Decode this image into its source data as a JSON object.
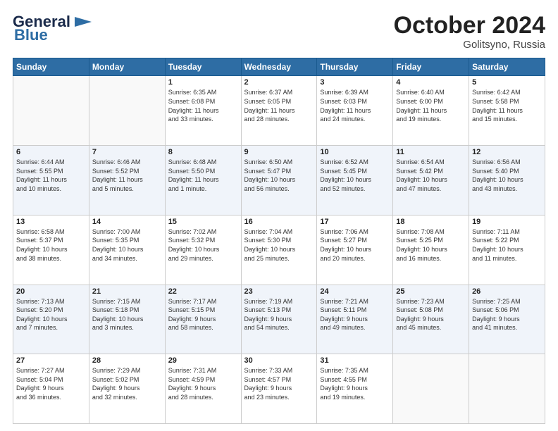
{
  "header": {
    "logo_line1": "General",
    "logo_line2": "Blue",
    "month_year": "October 2024",
    "location": "Golitsyno, Russia"
  },
  "weekdays": [
    "Sunday",
    "Monday",
    "Tuesday",
    "Wednesday",
    "Thursday",
    "Friday",
    "Saturday"
  ],
  "weeks": [
    [
      {
        "day": "",
        "detail": ""
      },
      {
        "day": "",
        "detail": ""
      },
      {
        "day": "1",
        "detail": "Sunrise: 6:35 AM\nSunset: 6:08 PM\nDaylight: 11 hours\nand 33 minutes."
      },
      {
        "day": "2",
        "detail": "Sunrise: 6:37 AM\nSunset: 6:05 PM\nDaylight: 11 hours\nand 28 minutes."
      },
      {
        "day": "3",
        "detail": "Sunrise: 6:39 AM\nSunset: 6:03 PM\nDaylight: 11 hours\nand 24 minutes."
      },
      {
        "day": "4",
        "detail": "Sunrise: 6:40 AM\nSunset: 6:00 PM\nDaylight: 11 hours\nand 19 minutes."
      },
      {
        "day": "5",
        "detail": "Sunrise: 6:42 AM\nSunset: 5:58 PM\nDaylight: 11 hours\nand 15 minutes."
      }
    ],
    [
      {
        "day": "6",
        "detail": "Sunrise: 6:44 AM\nSunset: 5:55 PM\nDaylight: 11 hours\nand 10 minutes."
      },
      {
        "day": "7",
        "detail": "Sunrise: 6:46 AM\nSunset: 5:52 PM\nDaylight: 11 hours\nand 5 minutes."
      },
      {
        "day": "8",
        "detail": "Sunrise: 6:48 AM\nSunset: 5:50 PM\nDaylight: 11 hours\nand 1 minute."
      },
      {
        "day": "9",
        "detail": "Sunrise: 6:50 AM\nSunset: 5:47 PM\nDaylight: 10 hours\nand 56 minutes."
      },
      {
        "day": "10",
        "detail": "Sunrise: 6:52 AM\nSunset: 5:45 PM\nDaylight: 10 hours\nand 52 minutes."
      },
      {
        "day": "11",
        "detail": "Sunrise: 6:54 AM\nSunset: 5:42 PM\nDaylight: 10 hours\nand 47 minutes."
      },
      {
        "day": "12",
        "detail": "Sunrise: 6:56 AM\nSunset: 5:40 PM\nDaylight: 10 hours\nand 43 minutes."
      }
    ],
    [
      {
        "day": "13",
        "detail": "Sunrise: 6:58 AM\nSunset: 5:37 PM\nDaylight: 10 hours\nand 38 minutes."
      },
      {
        "day": "14",
        "detail": "Sunrise: 7:00 AM\nSunset: 5:35 PM\nDaylight: 10 hours\nand 34 minutes."
      },
      {
        "day": "15",
        "detail": "Sunrise: 7:02 AM\nSunset: 5:32 PM\nDaylight: 10 hours\nand 29 minutes."
      },
      {
        "day": "16",
        "detail": "Sunrise: 7:04 AM\nSunset: 5:30 PM\nDaylight: 10 hours\nand 25 minutes."
      },
      {
        "day": "17",
        "detail": "Sunrise: 7:06 AM\nSunset: 5:27 PM\nDaylight: 10 hours\nand 20 minutes."
      },
      {
        "day": "18",
        "detail": "Sunrise: 7:08 AM\nSunset: 5:25 PM\nDaylight: 10 hours\nand 16 minutes."
      },
      {
        "day": "19",
        "detail": "Sunrise: 7:11 AM\nSunset: 5:22 PM\nDaylight: 10 hours\nand 11 minutes."
      }
    ],
    [
      {
        "day": "20",
        "detail": "Sunrise: 7:13 AM\nSunset: 5:20 PM\nDaylight: 10 hours\nand 7 minutes."
      },
      {
        "day": "21",
        "detail": "Sunrise: 7:15 AM\nSunset: 5:18 PM\nDaylight: 10 hours\nand 3 minutes."
      },
      {
        "day": "22",
        "detail": "Sunrise: 7:17 AM\nSunset: 5:15 PM\nDaylight: 9 hours\nand 58 minutes."
      },
      {
        "day": "23",
        "detail": "Sunrise: 7:19 AM\nSunset: 5:13 PM\nDaylight: 9 hours\nand 54 minutes."
      },
      {
        "day": "24",
        "detail": "Sunrise: 7:21 AM\nSunset: 5:11 PM\nDaylight: 9 hours\nand 49 minutes."
      },
      {
        "day": "25",
        "detail": "Sunrise: 7:23 AM\nSunset: 5:08 PM\nDaylight: 9 hours\nand 45 minutes."
      },
      {
        "day": "26",
        "detail": "Sunrise: 7:25 AM\nSunset: 5:06 PM\nDaylight: 9 hours\nand 41 minutes."
      }
    ],
    [
      {
        "day": "27",
        "detail": "Sunrise: 7:27 AM\nSunset: 5:04 PM\nDaylight: 9 hours\nand 36 minutes."
      },
      {
        "day": "28",
        "detail": "Sunrise: 7:29 AM\nSunset: 5:02 PM\nDaylight: 9 hours\nand 32 minutes."
      },
      {
        "day": "29",
        "detail": "Sunrise: 7:31 AM\nSunset: 4:59 PM\nDaylight: 9 hours\nand 28 minutes."
      },
      {
        "day": "30",
        "detail": "Sunrise: 7:33 AM\nSunset: 4:57 PM\nDaylight: 9 hours\nand 23 minutes."
      },
      {
        "day": "31",
        "detail": "Sunrise: 7:35 AM\nSunset: 4:55 PM\nDaylight: 9 hours\nand 19 minutes."
      },
      {
        "day": "",
        "detail": ""
      },
      {
        "day": "",
        "detail": ""
      }
    ]
  ]
}
